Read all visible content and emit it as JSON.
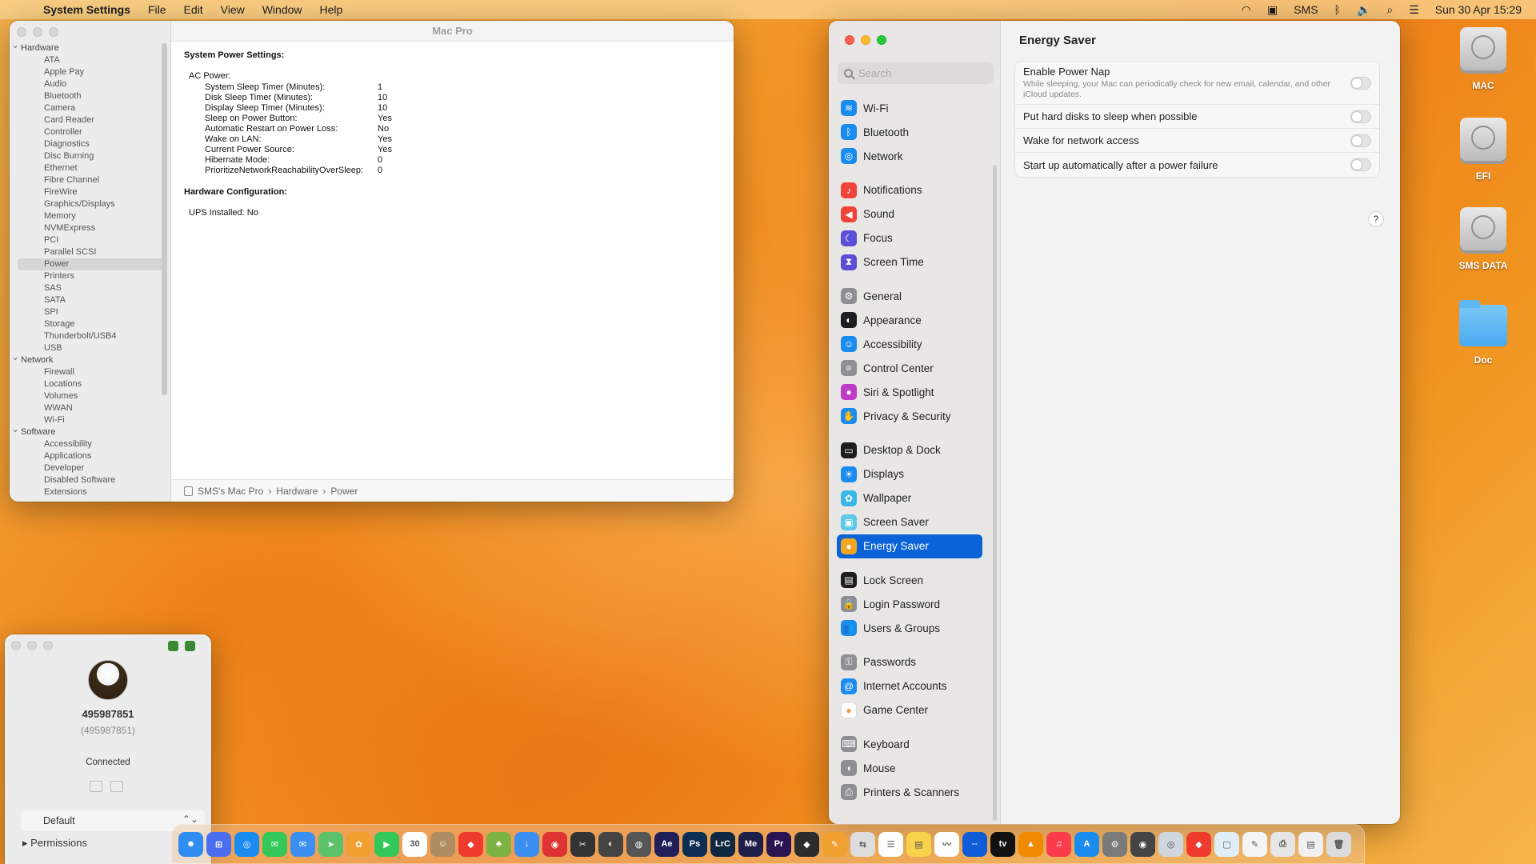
{
  "menubar": {
    "app_name": "System Settings",
    "menus": [
      "File",
      "Edit",
      "View",
      "Window",
      "Help"
    ],
    "status_text": "SMS",
    "datetime": "Sun 30 Apr  15:29"
  },
  "sysinfo": {
    "title": "Mac Pro",
    "tree": [
      {
        "type": "group",
        "label": "Hardware"
      },
      {
        "type": "leaf",
        "label": "ATA"
      },
      {
        "type": "leaf",
        "label": "Apple Pay"
      },
      {
        "type": "leaf",
        "label": "Audio"
      },
      {
        "type": "leaf",
        "label": "Bluetooth"
      },
      {
        "type": "leaf",
        "label": "Camera"
      },
      {
        "type": "leaf",
        "label": "Card Reader"
      },
      {
        "type": "leaf",
        "label": "Controller"
      },
      {
        "type": "leaf",
        "label": "Diagnostics"
      },
      {
        "type": "leaf",
        "label": "Disc Burning"
      },
      {
        "type": "leaf",
        "label": "Ethernet"
      },
      {
        "type": "leaf",
        "label": "Fibre Channel"
      },
      {
        "type": "leaf",
        "label": "FireWire"
      },
      {
        "type": "leaf",
        "label": "Graphics/Displays"
      },
      {
        "type": "leaf",
        "label": "Memory"
      },
      {
        "type": "leaf",
        "label": "NVMExpress"
      },
      {
        "type": "leaf",
        "label": "PCI"
      },
      {
        "type": "leaf",
        "label": "Parallel SCSI"
      },
      {
        "type": "leaf",
        "label": "Power",
        "selected": true
      },
      {
        "type": "leaf",
        "label": "Printers"
      },
      {
        "type": "leaf",
        "label": "SAS"
      },
      {
        "type": "leaf",
        "label": "SATA"
      },
      {
        "type": "leaf",
        "label": "SPI"
      },
      {
        "type": "leaf",
        "label": "Storage"
      },
      {
        "type": "leaf",
        "label": "Thunderbolt/USB4"
      },
      {
        "type": "leaf",
        "label": "USB"
      },
      {
        "type": "group",
        "label": "Network"
      },
      {
        "type": "leaf",
        "label": "Firewall"
      },
      {
        "type": "leaf",
        "label": "Locations"
      },
      {
        "type": "leaf",
        "label": "Volumes"
      },
      {
        "type": "leaf",
        "label": "WWAN"
      },
      {
        "type": "leaf",
        "label": "Wi-Fi"
      },
      {
        "type": "group",
        "label": "Software"
      },
      {
        "type": "leaf",
        "label": "Accessibility"
      },
      {
        "type": "leaf",
        "label": "Applications"
      },
      {
        "type": "leaf",
        "label": "Developer"
      },
      {
        "type": "leaf",
        "label": "Disabled Software"
      },
      {
        "type": "leaf",
        "label": "Extensions"
      }
    ],
    "heading": "System Power Settings:",
    "ac_power_label": "AC Power:",
    "settings": [
      {
        "key": "System Sleep Timer (Minutes):",
        "value": "1"
      },
      {
        "key": "Disk Sleep Timer (Minutes):",
        "value": "10"
      },
      {
        "key": "Display Sleep Timer (Minutes):",
        "value": "10"
      },
      {
        "key": "Sleep on Power Button:",
        "value": "Yes"
      },
      {
        "key": "Automatic Restart on Power Loss:",
        "value": "No"
      },
      {
        "key": "Wake on LAN:",
        "value": "Yes"
      },
      {
        "key": "Current Power Source:",
        "value": "Yes"
      },
      {
        "key": "Hibernate Mode:",
        "value": "0"
      },
      {
        "key": "PrioritizeNetworkReachabilityOverSleep:",
        "value": "0"
      }
    ],
    "hw_heading": "Hardware Configuration:",
    "ups": "UPS Installed:   No",
    "path": [
      "SMS's Mac Pro",
      "Hardware",
      "Power"
    ]
  },
  "settings": {
    "search_placeholder": "Search",
    "nav": [
      {
        "label": "Wi-Fi",
        "icon": "wifi-icon",
        "color": "#1a8cf0",
        "glyph": "≋"
      },
      {
        "label": "Bluetooth",
        "icon": "bluetooth-icon",
        "color": "#1a8cf0",
        "glyph": "ᛒ"
      },
      {
        "label": "Network",
        "icon": "globe-icon",
        "color": "#1a8cf0",
        "glyph": "◎"
      },
      {
        "label": "Notifications",
        "icon": "bell-icon",
        "color": "#f0443a",
        "glyph": "♪",
        "gap": true
      },
      {
        "label": "Sound",
        "icon": "speaker-icon",
        "color": "#f0443a",
        "glyph": "◀"
      },
      {
        "label": "Focus",
        "icon": "moon-icon",
        "color": "#5b4fd6",
        "glyph": "☾"
      },
      {
        "label": "Screen Time",
        "icon": "hourglass-icon",
        "color": "#5b4fd6",
        "glyph": "⧗"
      },
      {
        "label": "General",
        "icon": "gear-icon",
        "color": "#8e8e93",
        "glyph": "⚙",
        "gap": true
      },
      {
        "label": "Appearance",
        "icon": "appearance-icon",
        "color": "#1d1d1f",
        "glyph": "◐"
      },
      {
        "label": "Accessibility",
        "icon": "accessibility-icon",
        "color": "#1a8cf0",
        "glyph": "☺"
      },
      {
        "label": "Control Center",
        "icon": "control-center-icon",
        "color": "#8e8e93",
        "glyph": "≡"
      },
      {
        "label": "Siri & Spotlight",
        "icon": "siri-icon",
        "color": "#c03ac8",
        "glyph": "●"
      },
      {
        "label": "Privacy & Security",
        "icon": "hand-icon",
        "color": "#1a8cf0",
        "glyph": "✋"
      },
      {
        "label": "Desktop & Dock",
        "icon": "dock-icon",
        "color": "#1d1d1f",
        "glyph": "▭",
        "gap": true
      },
      {
        "label": "Displays",
        "icon": "sun-icon",
        "color": "#1a8cf0",
        "glyph": "☀"
      },
      {
        "label": "Wallpaper",
        "icon": "wallpaper-icon",
        "color": "#3cb8e6",
        "glyph": "✿"
      },
      {
        "label": "Screen Saver",
        "icon": "screen-saver-icon",
        "color": "#5ac8e6",
        "glyph": "▣"
      },
      {
        "label": "Energy Saver",
        "icon": "bulb-icon",
        "color": "#f5a623",
        "glyph": "●",
        "selected": true
      },
      {
        "label": "Lock Screen",
        "icon": "lock-screen-icon",
        "color": "#1d1d1f",
        "glyph": "▤",
        "gap": true
      },
      {
        "label": "Login Password",
        "icon": "lock-icon",
        "color": "#8e8e93",
        "glyph": "🔒"
      },
      {
        "label": "Users & Groups",
        "icon": "users-icon",
        "color": "#1a8cf0",
        "glyph": "👥"
      },
      {
        "label": "Passwords",
        "icon": "key-icon",
        "color": "#8e8e93",
        "glyph": "⚿",
        "gap": true
      },
      {
        "label": "Internet Accounts",
        "icon": "at-icon",
        "color": "#1a8cf0",
        "glyph": "@"
      },
      {
        "label": "Game Center",
        "icon": "game-center-icon",
        "color": "#ffffff",
        "glyph": "●"
      },
      {
        "label": "Keyboard",
        "icon": "keyboard-icon",
        "color": "#8e8e93",
        "glyph": "⌨",
        "gap": true
      },
      {
        "label": "Mouse",
        "icon": "mouse-icon",
        "color": "#8e8e93",
        "glyph": "◖"
      },
      {
        "label": "Printers & Scanners",
        "icon": "printer-icon",
        "color": "#8e8e93",
        "glyph": "⎙"
      }
    ],
    "pane_title": "Energy Saver",
    "options": [
      {
        "title": "Enable Power Nap",
        "desc": "While sleeping, your Mac can periodically check for new email, calendar, and other iCloud updates.",
        "on": false
      },
      {
        "title": "Put hard disks to sleep when possible",
        "desc": "",
        "on": false
      },
      {
        "title": "Wake for network access",
        "desc": "",
        "on": false
      },
      {
        "title": "Start up automatically after a power failure",
        "desc": "",
        "on": false
      }
    ],
    "help_label": "?"
  },
  "remote": {
    "id": "495987851",
    "id_sub": "(495987851)",
    "status": "Connected",
    "dropdown": "Default",
    "permissions": "Permissions"
  },
  "desktop": [
    {
      "label": "MAC",
      "kind": "disk"
    },
    {
      "label": "EFI",
      "kind": "disk"
    },
    {
      "label": "SMS DATA",
      "kind": "disk"
    },
    {
      "label": "Doc",
      "kind": "folder"
    }
  ],
  "dock": [
    {
      "name": "finder",
      "color": "#2f8cf0",
      "glyph": "☻"
    },
    {
      "name": "launchpad",
      "color": "#4b6ef0",
      "glyph": "⊞"
    },
    {
      "name": "safari",
      "color": "#1a8cf0",
      "glyph": "◎"
    },
    {
      "name": "messages",
      "color": "#34c759",
      "glyph": "✉"
    },
    {
      "name": "mail",
      "color": "#3a8ff0",
      "glyph": "✉"
    },
    {
      "name": "maps",
      "color": "#5cc26a",
      "glyph": "➤"
    },
    {
      "name": "photos",
      "color": "#f0a030",
      "glyph": "✿"
    },
    {
      "name": "facetime",
      "color": "#34c759",
      "glyph": "▶"
    },
    {
      "name": "calendar",
      "color": "#ffffff",
      "glyph": "30"
    },
    {
      "name": "contacts",
      "color": "#b08c62",
      "glyph": "☺"
    },
    {
      "name": "anydesk",
      "color": "#ef3b2d",
      "glyph": "◆"
    },
    {
      "name": "android",
      "color": "#7cb342",
      "glyph": "♣"
    },
    {
      "name": "downloader",
      "color": "#3a8ff0",
      "glyph": "↓"
    },
    {
      "name": "davinci",
      "color": "#d33",
      "glyph": "◉"
    },
    {
      "name": "final-cut",
      "color": "#333",
      "glyph": "✂"
    },
    {
      "name": "motion",
      "color": "#444",
      "glyph": "◐"
    },
    {
      "name": "compressor",
      "color": "#555",
      "glyph": "◍"
    },
    {
      "name": "after-effects",
      "color": "#1f1f5a",
      "glyph": "Ae"
    },
    {
      "name": "photoshop",
      "color": "#0c2e52",
      "glyph": "Ps"
    },
    {
      "name": "lightroom",
      "color": "#0f2740",
      "glyph": "LrC"
    },
    {
      "name": "media-encoder",
      "color": "#1e1e4a",
      "glyph": "Me"
    },
    {
      "name": "premiere",
      "color": "#2a1451",
      "glyph": "Pr"
    },
    {
      "name": "resolve",
      "color": "#2c2c2c",
      "glyph": "◆"
    },
    {
      "name": "vectornator",
      "color": "#f0a030",
      "glyph": "✎"
    },
    {
      "name": "terminal-like",
      "color": "#ddd",
      "glyph": "⇆"
    },
    {
      "name": "reminders",
      "color": "#ffffff",
      "glyph": "☰"
    },
    {
      "name": "notes",
      "color": "#f8d24a",
      "glyph": "▤"
    },
    {
      "name": "freeform",
      "color": "#ffffff",
      "glyph": "〰"
    },
    {
      "name": "teamviewer",
      "color": "#0e5cd8",
      "glyph": "⇔"
    },
    {
      "name": "apple-tv",
      "color": "#111",
      "glyph": "tv"
    },
    {
      "name": "vlc",
      "color": "#f08a00",
      "glyph": "▲"
    },
    {
      "name": "music",
      "color": "#fa3c4c",
      "glyph": "♫"
    },
    {
      "name": "app-store",
      "color": "#1a8cf0",
      "glyph": "A"
    },
    {
      "name": "system-settings",
      "color": "#7a7a7a",
      "glyph": "⚙"
    },
    {
      "name": "system-info",
      "color": "#444",
      "glyph": "◉"
    },
    {
      "name": "quicktime",
      "color": "#cfd6de",
      "glyph": "◎"
    },
    {
      "name": "anydesk-2",
      "color": "#ef3b2d",
      "glyph": "◆"
    },
    {
      "name": "preview",
      "color": "#e0eef8",
      "glyph": "▢"
    },
    {
      "name": "textedit",
      "color": "#f4f4f4",
      "glyph": "✎"
    },
    {
      "name": "printer",
      "color": "#e6e6e6",
      "glyph": "⎙"
    },
    {
      "name": "documents",
      "color": "#f0f0f0",
      "glyph": "▤"
    },
    {
      "name": "trash",
      "color": "#dcdcdc",
      "glyph": "🗑"
    }
  ]
}
